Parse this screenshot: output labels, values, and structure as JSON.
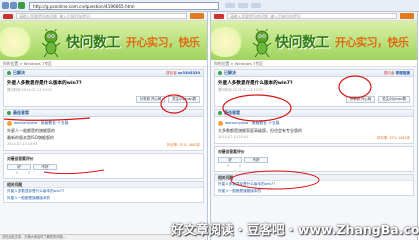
{
  "browser": {
    "address": "http://g.pconline.com.cn/question/4196665.html"
  },
  "left": {
    "search_placeholder": "请输入您要提问的问题, 输入后按回车提问",
    "banner_title": "快问数工",
    "banner_slogan": "开心实习，快乐",
    "breadcrumb": "你的位置 > Windows 7专区",
    "status_label": "已解决",
    "meta_prefix": "提问者",
    "meta_value": "sx3305320",
    "question": "外星人多数显存是什么版本的win7?",
    "question_date": "提问时间 2013-07-13 10:37",
    "btn_share": "分享到 开心网",
    "btn_follow": "关注QQ/msn群",
    "best_answer_label": "最佳答案",
    "answer_user": "womanyoba · 高级教长 十五级",
    "answer_text": "外星人一般都是的旗舰版的",
    "answer_text2": "最新的版本是ISO旗舰版的",
    "answer_date": "2013-07-13 10:41",
    "answer_rate": "好评率: 37% 1485评",
    "eval_label": "对最佳答案评价",
    "eval_good": "好",
    "eval_bad": "不好",
    "eval_good_count": "0",
    "eval_bad_count": "0",
    "related_head": "相关问题",
    "related": [
      "外星人多数显存是什么版本的win7?",
      "外星人一般都是旗舰版本的"
    ]
  },
  "right": {
    "search_placeholder": "请输入您要提问的问题, 输入后按回车提问",
    "banner_title": "快问数工",
    "banner_slogan": "开心实习，快乐",
    "breadcrumb": "你的位置 > Windows 7专区",
    "status_label": "已解决",
    "meta_prefix": "提问者",
    "meta_value": "笨瑶瑶蛋",
    "question": "外星人多数显存是什么版本的win7?",
    "question_date": "提问时间 2013-07-13 10:37",
    "btn_share": "分享到 开心网",
    "btn_follow": "关注QQ/msn群",
    "best_answer_label": "最佳答案",
    "answer_user": "womanyoba · 高级教长 十五级",
    "answer_text": "大多数都是旗舰家庭高级版，但也会有专业版的",
    "answer_date": "2013-07-13 10:41",
    "answer_rate": "好评率: 37% 1485评",
    "eval_label": "对最佳答案评价",
    "eval_good": "好",
    "eval_bad": "不好",
    "eval_good_count": "0",
    "eval_bad_count": "0",
    "related_head": "相关问题",
    "related": [
      "外星人多数显存是什么版本的win7?",
      "外星人一般都是旗舰版本的"
    ]
  },
  "status_text": "请在此贴文章，方便大家及时了解您的问题…",
  "watermark": "好文章阅读 · 豆客吧 · www.ZhangBa.com",
  "colors": {
    "banner_green": "#9fd35e",
    "title_green": "#2f7d14",
    "slogan_orange": "#e06a14",
    "link_blue": "#1a56a8",
    "annotation_red": "#d81414"
  }
}
